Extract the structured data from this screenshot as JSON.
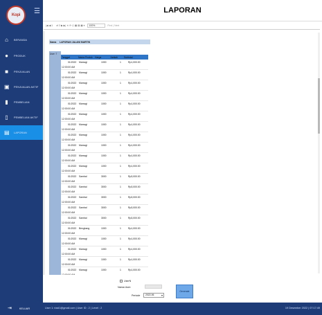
{
  "app": {
    "logo_text": "Kopi",
    "page_title": "LAPORAN"
  },
  "sidebar": {
    "items": [
      {
        "label": "BERANDA",
        "icon": "home-icon",
        "glyph": "⌂"
      },
      {
        "label": "PRODUK",
        "icon": "cart-icon",
        "glyph": "●"
      },
      {
        "label": "PENJUALAN",
        "icon": "cash-icon",
        "glyph": "■"
      },
      {
        "label": "PENJUALAN AKTIF",
        "icon": "cash-active-icon",
        "glyph": "▣"
      },
      {
        "label": "PEMBELIAN",
        "icon": "bag-icon",
        "glyph": "▮"
      },
      {
        "label": "PEMBELIAN AKTIF",
        "icon": "bag-active-icon",
        "glyph": "▯"
      },
      {
        "label": "LAPORAN",
        "icon": "report-icon",
        "glyph": "▤"
      }
    ]
  },
  "toolbar": {
    "nav": "|◀ ◀ 1",
    "controls": "of 2 ▶ ▶| ✕ ⟳ ⎙ ▦ ▤ ▣ ▾",
    "zoom": "100%",
    "find": "Find | Next"
  },
  "report": {
    "name_label": "Nama",
    "title": "LAPORAN JALANI MARTIN",
    "user_label": "User: 7",
    "columns": {
      "tanggal": "Tanggal",
      "nama_produk": "Nama Produk",
      "harga": "Harga",
      "jumlah": "Jumlah",
      "subtotal": "Subtotal"
    },
    "rows": [
      {
        "d1": "01/2022",
        "d2": "12:00:00 AM",
        "produk": "Mamogi",
        "harga": "1000",
        "jumlah": "1",
        "subtotal": "Rp1,000.00"
      },
      {
        "d1": "01/2022",
        "d2": "12:00:00 AM",
        "produk": "Mamogi",
        "harga": "1000",
        "jumlah": "1",
        "subtotal": "Rp1,000.00"
      },
      {
        "d1": "01/2022",
        "d2": "12:00:00 AM",
        "produk": "Mamogi",
        "harga": "1000",
        "jumlah": "1",
        "subtotal": "Rp1,000.00"
      },
      {
        "d1": "01/2022",
        "d2": "12:00:00 AM",
        "produk": "Mamogi",
        "harga": "1000",
        "jumlah": "1",
        "subtotal": "Rp1,000.00"
      },
      {
        "d1": "01/2022",
        "d2": "12:00:00 AM",
        "produk": "Mamogi",
        "harga": "1000",
        "jumlah": "1",
        "subtotal": "Rp1,000.00"
      },
      {
        "d1": "01/2022",
        "d2": "12:00:00 AM",
        "produk": "Mamogi",
        "harga": "1000",
        "jumlah": "1",
        "subtotal": "Rp1,000.00"
      },
      {
        "d1": "01/2022",
        "d2": "12:00:00 AM",
        "produk": "Mamogi",
        "harga": "1000",
        "jumlah": "1",
        "subtotal": "Rp1,000.00"
      },
      {
        "d1": "01/2022",
        "d2": "12:00:00 AM",
        "produk": "Mamogi",
        "harga": "1000",
        "jumlah": "1",
        "subtotal": "Rp1,000.00"
      },
      {
        "d1": "01/2022",
        "d2": "12:00:00 AM",
        "produk": "Mamogi",
        "harga": "1000",
        "jumlah": "1",
        "subtotal": "Rp1,000.00"
      },
      {
        "d1": "01/2022",
        "d2": "12:00:00 AM",
        "produk": "Mamogi",
        "harga": "1000",
        "jumlah": "1",
        "subtotal": "Rp1,000.00"
      },
      {
        "d1": "01/2022",
        "d2": "12:00:00 AM",
        "produk": "Mamogi",
        "harga": "1000",
        "jumlah": "1",
        "subtotal": "Rp1,000.00"
      },
      {
        "d1": "01/2022",
        "d2": "12:00:00 AM",
        "produk": "Sambal",
        "harga": "3000",
        "jumlah": "1",
        "subtotal": "Rp3,000.00"
      },
      {
        "d1": "01/2022",
        "d2": "12:00:00 AM",
        "produk": "Sambal",
        "harga": "3000",
        "jumlah": "1",
        "subtotal": "Rp3,000.00"
      },
      {
        "d1": "01/2022",
        "d2": "12:00:00 AM",
        "produk": "Sambal",
        "harga": "3000",
        "jumlah": "1",
        "subtotal": "Rp3,000.00"
      },
      {
        "d1": "01/2022",
        "d2": "12:00:00 AM",
        "produk": "Sambal",
        "harga": "3000",
        "jumlah": "1",
        "subtotal": "Rp3,000.00"
      },
      {
        "d1": "01/2022",
        "d2": "12:00:00 AM",
        "produk": "Sambal",
        "harga": "3000",
        "jumlah": "1",
        "subtotal": "Rp3,000.00"
      },
      {
        "d1": "01/2022",
        "d2": "12:00:00 AM",
        "produk": "Bengkang",
        "harga": "1000",
        "jumlah": "1",
        "subtotal": "Rp1,000.00"
      },
      {
        "d1": "01/2022",
        "d2": "12:00:00 AM",
        "produk": "Mamogi",
        "harga": "1000",
        "jumlah": "1",
        "subtotal": "Rp1,000.00"
      },
      {
        "d1": "01/2022",
        "d2": "12:00:00 AM",
        "produk": "Mamogi",
        "harga": "1000",
        "jumlah": "1",
        "subtotal": "Rp1,000.00"
      },
      {
        "d1": "01/2022",
        "d2": "12:00:00 AM",
        "produk": "Mamogi",
        "harga": "1000",
        "jumlah": "1",
        "subtotal": "Rp1,000.00"
      },
      {
        "d1": "01/2022",
        "d2": "12:00:00 AM",
        "produk": "Mamogi",
        "harga": "1000",
        "jumlah": "1",
        "subtotal": "Rp1,000.00"
      }
    ]
  },
  "controls": {
    "user_checkbox_label": "UserN",
    "nama_user_label": "Nama User:",
    "periode_label": "Periode",
    "periode_value": "2022-06",
    "generate_label": "Generate"
  },
  "status": {
    "keluar_label": "KELUAR",
    "keluar_icon": "logout-icon",
    "user_info": "User 1: rizal1@gmail.com | User ID : 2 | Level : 2",
    "date": "19 Desember 2022 | 07:17:49"
  },
  "colors": {
    "sidebar_bg": "#1d3c78",
    "active_item": "#1a8fe6",
    "table_header": "#2e75c8"
  }
}
